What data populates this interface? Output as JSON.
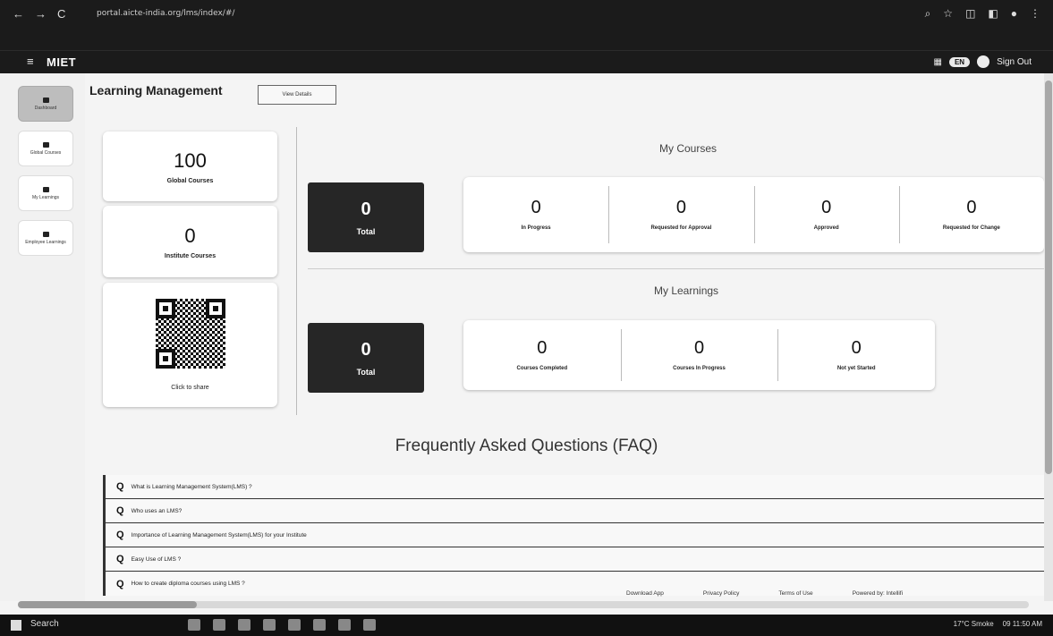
{
  "browser": {
    "url": "portal.aicte-india.org/lms/index/#/",
    "nav_back": "←",
    "nav_forward": "→",
    "nav_reload": "C",
    "icons": [
      "search-icon",
      "star-icon",
      "extension-icon",
      "sidebar-icon",
      "profile-icon",
      "more-icon"
    ]
  },
  "app": {
    "menu_glyph": "≡",
    "title": "MIET",
    "lang": "EN",
    "sign_out": "Sign Out"
  },
  "rail": {
    "items": [
      {
        "label": "Dashboard"
      },
      {
        "label": "Global Courses"
      },
      {
        "label": "My Learnings"
      },
      {
        "label": "Employee Learnings"
      }
    ]
  },
  "page": {
    "title": "Learning Management",
    "view_button": "View Details"
  },
  "stats": {
    "global_courses": {
      "value": "100",
      "label": "Global Courses"
    },
    "institute_courses": {
      "value": "0",
      "label": "Institute Courses"
    },
    "qr_label": "Click to share"
  },
  "my_courses": {
    "title": "My Courses",
    "total": {
      "value": "0",
      "label": "Total"
    },
    "metrics": [
      {
        "value": "0",
        "label": "In Progress"
      },
      {
        "value": "0",
        "label": "Requested for Approval"
      },
      {
        "value": "0",
        "label": "Approved"
      },
      {
        "value": "0",
        "label": "Requested for Change"
      }
    ]
  },
  "my_learnings": {
    "title": "My Learnings",
    "total": {
      "value": "0",
      "label": "Total"
    },
    "metrics": [
      {
        "value": "0",
        "label": "Courses Completed"
      },
      {
        "value": "0",
        "label": "Courses In Progress"
      },
      {
        "value": "0",
        "label": "Not yet Started"
      }
    ]
  },
  "faq": {
    "title": "Frequently Asked Questions (FAQ)",
    "q_glyph": "Q",
    "items": [
      "What is Learning Management System(LMS) ?",
      "Who uses an LMS?",
      "Importance of Learning Management System(LMS) for your Institute",
      "Easy Use of LMS ?",
      "How to create diploma courses using LMS ?"
    ]
  },
  "footer": {
    "download": "Download App",
    "privacy": "Privacy Policy",
    "terms": "Terms of Use",
    "powered": "Powered by: Intellifi"
  },
  "taskbar": {
    "search": "Search",
    "weather": "17°C Smoke",
    "time": "09 11:50 AM"
  }
}
